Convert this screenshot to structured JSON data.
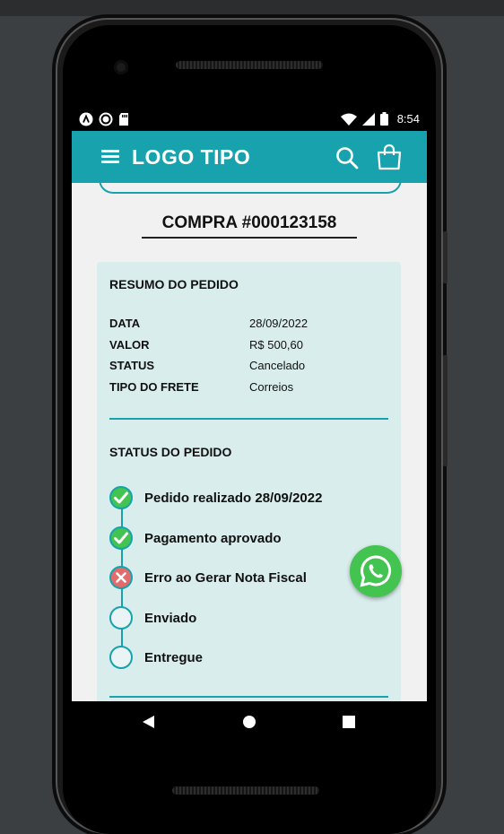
{
  "status_bar": {
    "time": "8:54",
    "left_icons": [
      "a-icon",
      "circle-icon",
      "sd-card-icon"
    ],
    "right_icons": [
      "wifi-icon",
      "signal-icon",
      "battery-icon"
    ]
  },
  "app_bar": {
    "logo_text": "LOGO TIPO",
    "menu_icon": "menu-icon",
    "search_icon": "search-icon",
    "bag_icon": "shopping-bag-icon",
    "color": "#17a2ad"
  },
  "order": {
    "title": "COMPRA #000123158"
  },
  "summary": {
    "heading": "RESUMO DO PEDIDO",
    "rows": [
      {
        "label": "DATA",
        "value": "28/09/2022"
      },
      {
        "label": "VALOR",
        "value": "R$ 500,60"
      },
      {
        "label": "STATUS",
        "value": "Cancelado"
      },
      {
        "label": "TIPO DO FRETE",
        "value": "Correios"
      }
    ]
  },
  "status": {
    "heading": "STATUS DO PEDIDO",
    "steps": [
      {
        "label": "Pedido realizado 28/09/2022",
        "state": "done"
      },
      {
        "label": "Pagamento aprovado",
        "state": "done"
      },
      {
        "label": "Erro ao Gerar Nota Fiscal",
        "state": "error"
      },
      {
        "label": "Enviado",
        "state": "pending"
      },
      {
        "label": "Entregue",
        "state": "pending"
      }
    ]
  },
  "colors": {
    "accent": "#17a2ad",
    "success": "#43c34f",
    "error": "#e36b6b",
    "card_bg": "#d9eded"
  },
  "fab": {
    "icon": "whatsapp-icon"
  },
  "nav_bar": {
    "icons": [
      "back-icon",
      "home-icon",
      "recents-icon"
    ]
  }
}
